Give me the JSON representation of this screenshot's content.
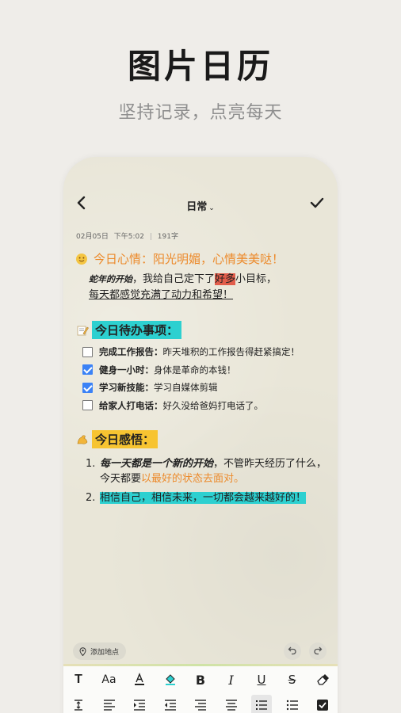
{
  "promo": {
    "title": "图片日历",
    "subtitle": "坚持记录，点亮每天"
  },
  "nav": {
    "category": "日常",
    "back_icon": "chevron-left-icon",
    "confirm_icon": "check-icon"
  },
  "meta": {
    "date": "02月05日",
    "time": "下午5:02",
    "word_count": "191字"
  },
  "mood": {
    "text": "今日心情：阳光明媚，心情美美哒！",
    "para_prefix": "蛇年的开始",
    "para_mid": "，我给自己定下了",
    "para_highlight": "好多",
    "para_suffix": "小目标，",
    "para_line2": "每天都感觉充满了动力和希望！"
  },
  "todo": {
    "heading": "今日待办事项：",
    "items": [
      {
        "key": "完成工作报告：",
        "text": "昨天堆积的工作报告得赶紧搞定！",
        "checked": false
      },
      {
        "key": "健身一小时：",
        "text": "身体是革命的本钱！",
        "checked": true
      },
      {
        "key": "学习新技能：",
        "text": "学习自媒体剪辑",
        "checked": true
      },
      {
        "key": "给家人打电话：",
        "text": "好久没给爸妈打电话了。",
        "checked": false
      }
    ]
  },
  "insight": {
    "heading": "今日感悟：",
    "items": [
      {
        "num": "1.",
        "bold": "每一天都是一个新的开始",
        "normal": "，不管昨天经历了什么，今天都要",
        "orange": "以最好的状态去面对。"
      },
      {
        "num": "2.",
        "teal": "相信自己，相信未来，一切都会越来越好的！"
      }
    ]
  },
  "bottom": {
    "location_label": "添加地点"
  },
  "toolbar": {
    "row1": [
      "T",
      "Aa",
      "A",
      "fill",
      "B",
      "I",
      "U",
      "S",
      "eraser"
    ],
    "row2": [
      "line-height",
      "align-left",
      "indent-increase",
      "indent-decrease",
      "align-right",
      "align-center",
      "ordered-list",
      "bullet-list",
      "checkbox"
    ]
  },
  "colors": {
    "accent_orange": "#ec8a2b",
    "highlight_teal": "#2dd0d0",
    "highlight_yellow": "#f7c431",
    "highlight_red": "#e25d4b",
    "checkbox_blue": "#3b82f6"
  }
}
